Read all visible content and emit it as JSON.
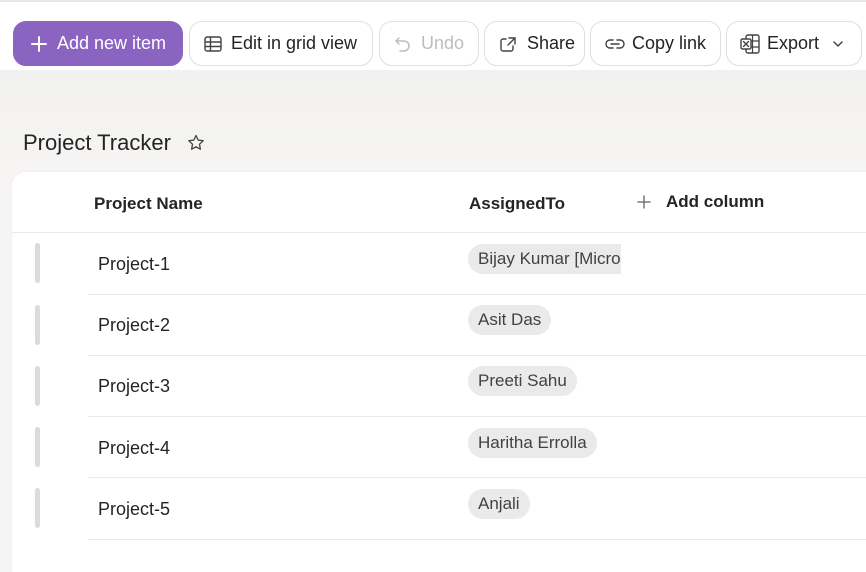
{
  "toolbar": {
    "add_new_item": "Add new item",
    "edit_grid_view": "Edit in grid view",
    "undo": "Undo",
    "share": "Share",
    "copy_link": "Copy link",
    "export": "Export"
  },
  "list": {
    "title": "Project Tracker"
  },
  "columns": {
    "project_name": "Project Name",
    "assigned_to": "AssignedTo",
    "add_column": "Add column"
  },
  "rows": [
    {
      "project": "Project-1",
      "assigned": "Bijay Kumar [Micro"
    },
    {
      "project": "Project-2",
      "assigned": "Asit Das"
    },
    {
      "project": "Project-3",
      "assigned": "Preeti Sahu"
    },
    {
      "project": "Project-4",
      "assigned": "Haritha Errolla"
    },
    {
      "project": "Project-5",
      "assigned": "Anjali"
    }
  ],
  "colors": {
    "accent": "#8a64c0",
    "chip_bg": "#ebeaea"
  }
}
